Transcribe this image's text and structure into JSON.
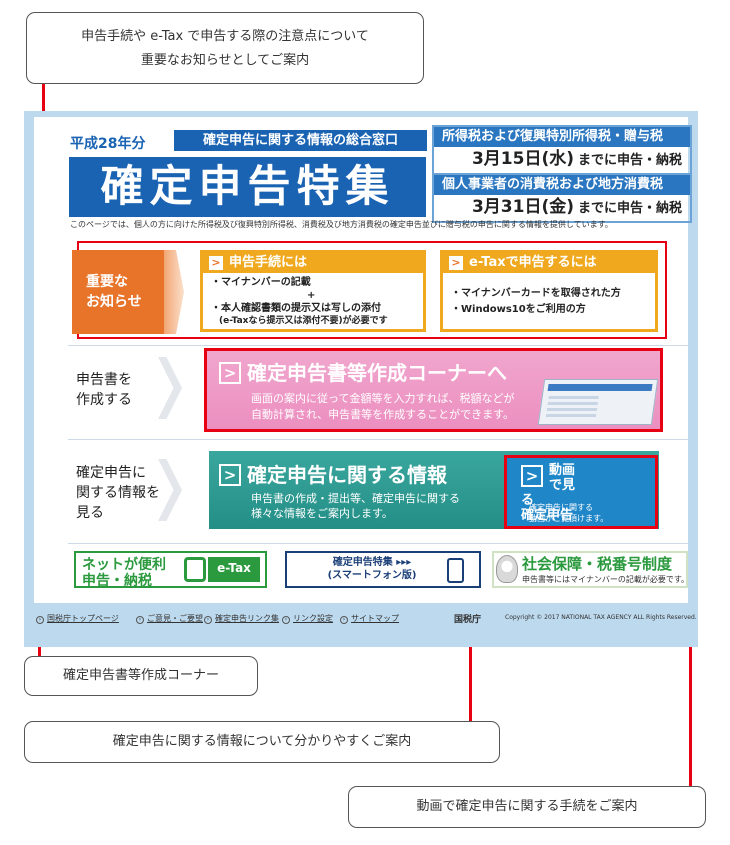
{
  "callouts": {
    "notice_line1": "申告手続や e-Tax で申告する際の注意点について",
    "notice_line2": "重要なお知らせとしてご案内",
    "sakusei": "確定申告書等作成コーナー",
    "info": "確定申告に関する情報について分かりやすくご案内",
    "douga": "動画で確定申告に関する手続をご案内"
  },
  "header": {
    "heisei": "平成28年分",
    "madoguchi": "確定申告に関する情報の総合窓口",
    "title": "確定申告特集",
    "deadline1_head": "所得税および復興特別所得税・贈与税",
    "deadline1_date": "3月15日(水)",
    "deadline1_suffix": "までに申告・納税",
    "deadline2_head": "個人事業者の消費税および地方消費税",
    "deadline2_date": "3月31日(金)",
    "deadline2_suffix": "までに申告・納税",
    "intro": "このページでは、個人の方に向けた所得税及び復興特別所得税、消費税及び地方消費税の確定申告並びに贈与税の申告に関する情報を提供しています。"
  },
  "notice": {
    "label_line1": "重要な",
    "label_line2": "お知らせ",
    "box1_title": "申告手続には",
    "box1_lines": [
      "・マイナンバーの記載",
      "+",
      "・本人確認書類の提示又は写しの添付",
      "(e-Taxなら提示又は添付不要)が必要です"
    ],
    "box2_title": "e-Taxで申告するには",
    "box2_lines": [
      "・マイナンバーカードを取得された方",
      "・Windows10をご利用の方"
    ]
  },
  "rows": {
    "row1_line1": "申告書を",
    "row1_line2": "作成する",
    "row2_line1": "確定申告に",
    "row2_line2": "関する情報を",
    "row2_line3": "見る"
  },
  "sakusei": {
    "title": "確定申告書等作成コーナーへ",
    "desc1": "画面の案内に従って金額等を入力すれば、税額などが",
    "desc2": "自動計算され、申告書等を作成することができます。"
  },
  "info": {
    "title": "確定申告に関する情報",
    "desc1": "申告書の作成・提出等、確定申告に関する",
    "desc2": "様々な情報をご案内します。"
  },
  "douga": {
    "title1": "動画で見る",
    "title2": "確定申告",
    "desc1": "確定申告に関する",
    "desc2": "動画がご覧頂けます。"
  },
  "banners": {
    "net_line1": "ネットが便利",
    "net_line2": "申告・納税",
    "etax": "e-Tax",
    "sp_line1": "確定申告特集 ▸▸▸",
    "sp_line2": "(スマートフォン版)",
    "shakai_line1": "社会保障・税番号制度",
    "shakai_line2": "申告書等にはマイナンバーの記載が必要です。"
  },
  "footer": {
    "links": [
      "国税庁トップページ",
      "ご意見・ご要望",
      "確定申告リンク集",
      "リンク設定",
      "サイトマップ"
    ],
    "logo": "国税庁",
    "copyright": "Copyright © 2017 NATIONAL TAX AGENCY ALL Rights Reserved."
  },
  "colors": {
    "highlight_red": "#e60012",
    "title_blue": "#1a63b3",
    "notice_orange": "#e8742a",
    "sakusei_pink": "#ec8fc0",
    "info_teal": "#238e86"
  }
}
